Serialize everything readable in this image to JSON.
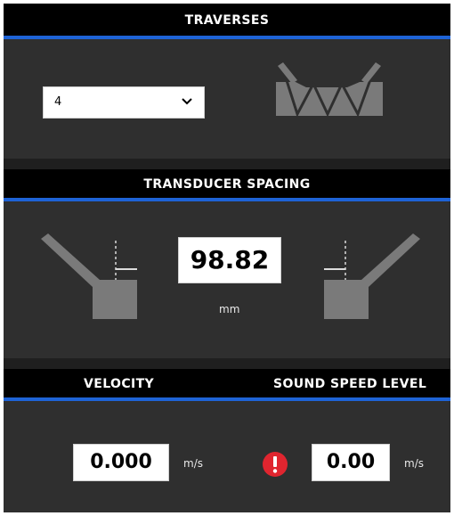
{
  "traverses": {
    "title": "TRAVERSES",
    "selected_value": "4",
    "icon": "chevron-down-icon"
  },
  "transducer_spacing": {
    "title": "TRANSDUCER SPACING",
    "value": "98.82",
    "unit": "mm"
  },
  "velocity": {
    "title": "VELOCITY",
    "value": "0.000",
    "unit": "m/s"
  },
  "sound_speed_level": {
    "title": "SOUND SPEED LEVEL",
    "value": "0.00",
    "unit": "m/s",
    "alert_icon": "exclamation-icon"
  },
  "colors": {
    "panel_background": "#2f2f2f",
    "header_background": "#000000",
    "accent_line": "#1e63d6",
    "alert": "#e0252f",
    "diagram_fill": "#7a7a7a"
  }
}
